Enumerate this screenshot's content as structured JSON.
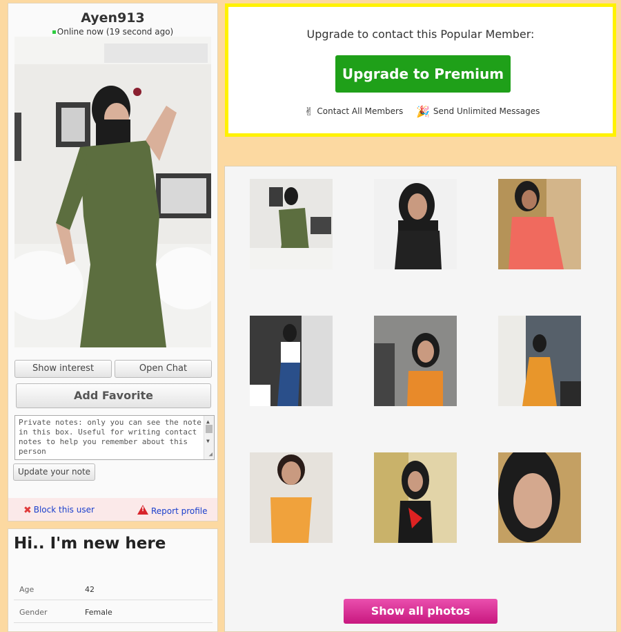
{
  "profile": {
    "username": "Ayen913",
    "online_status": "Online now (19 second ago)",
    "buttons": {
      "show_interest": "Show interest",
      "open_chat": "Open Chat",
      "add_favorite": "Add Favorite",
      "update_note": "Update your note"
    },
    "notes_placeholder": "Private notes: only you can see the note in this box. Useful for writing contact notes to help you remember about this person",
    "block_user": "Block this user",
    "report_profile": "Report profile"
  },
  "info": {
    "heading": "Hi.. I'm new here",
    "rows": [
      {
        "key": "Age",
        "value": "42"
      },
      {
        "key": "Gender",
        "value": "Female"
      }
    ]
  },
  "upgrade": {
    "prompt": "Upgrade to contact this Popular Member:",
    "button": "Upgrade to Premium",
    "feature_1": "Contact All Members",
    "feature_2": "Send Unlimited Messages"
  },
  "gallery": {
    "photo_count": 9,
    "show_all": "Show all photos"
  },
  "colors": {
    "page_bg": "#fcd9a1",
    "premium_green": "#1fa019",
    "upgrade_border": "#fff200",
    "show_all_pink": "#d92b93",
    "link_blue": "#1a3fcc"
  }
}
